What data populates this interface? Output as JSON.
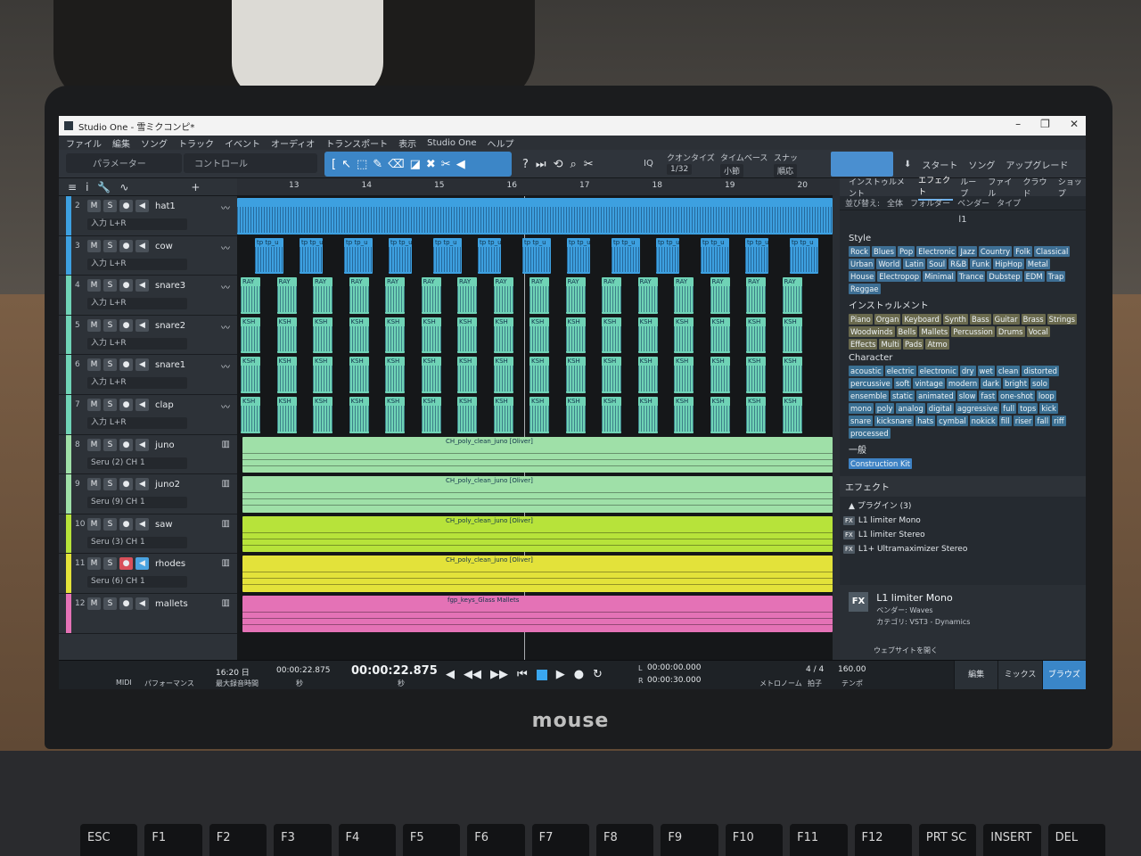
{
  "window": {
    "title": "Studio One - 雪ミクコンピ*"
  },
  "menu": [
    "ファイル",
    "編集",
    "ソング",
    "トラック",
    "イベント",
    "オーディオ",
    "トランスポート",
    "表示",
    "Studio One",
    "ヘルプ"
  ],
  "toolbar": {
    "param_label": "パラメーター",
    "control_label": "コントロール",
    "iq": "IQ",
    "quantize_label": "クオンタイズ",
    "quantize_value": "1/32",
    "timebase_label": "タイムベース",
    "timebase_value": "小節",
    "snap_label": "スナップ",
    "snap_value": "順応",
    "start": "スタート",
    "song": "ソング",
    "upgrade": "アップグレード"
  },
  "ruler": [
    "13",
    "14",
    "15",
    "16",
    "17",
    "18",
    "19",
    "20"
  ],
  "tracks": [
    {
      "num": "2",
      "name": "hat1",
      "input": "入力 L+R",
      "color": "#3da0e0"
    },
    {
      "num": "3",
      "name": "cow",
      "input": "入力 L+R",
      "color": "#3da0e0"
    },
    {
      "num": "4",
      "name": "snare3",
      "input": "入力 L+R",
      "color": "#6fd3b6"
    },
    {
      "num": "5",
      "name": "snare2",
      "input": "入力 L+R",
      "color": "#6fd3b6"
    },
    {
      "num": "6",
      "name": "snare1",
      "input": "入力 L+R",
      "color": "#6fd3b6"
    },
    {
      "num": "7",
      "name": "clap",
      "input": "入力 L+R",
      "color": "#6fd3b6"
    },
    {
      "num": "8",
      "name": "juno",
      "input": "Seru (2)   CH 1",
      "color": "#9fe0a8"
    },
    {
      "num": "9",
      "name": "juno2",
      "input": "Seru (9)   CH 1",
      "color": "#9fe0a8"
    },
    {
      "num": "10",
      "name": "saw",
      "input": "Seru (3)   CH 1",
      "color": "#b7e33a"
    },
    {
      "num": "11",
      "name": "rhodes",
      "input": "Seru (6)   CH 1",
      "color": "#e3e23a"
    },
    {
      "num": "12",
      "name": "mallets",
      "input": "",
      "color": "#e472b6"
    }
  ],
  "clips": {
    "hat": "tp tp_u",
    "snare": "RAY",
    "snare2": "KSH",
    "juno": "CH_poly_clean_juno [Oliver]",
    "mallets": "fgp_keys_Glass Mallets"
  },
  "browser": {
    "tabs": [
      "インストゥルメント",
      "エフェクト",
      "ループ",
      "ファイル",
      "クラウド",
      "ショップ"
    ],
    "sort": [
      "並び替え:",
      "全体",
      "フォルダー",
      "ベンダー",
      "タイプ"
    ],
    "search": "l1",
    "style_title": "Style",
    "style": [
      "Rock",
      "Blues",
      "Pop",
      "Electronic",
      "Jazz",
      "Country",
      "Folk",
      "Classical",
      "Urban",
      "World",
      "Latin",
      "Soul",
      "R&B",
      "Funk",
      "HipHop",
      "Metal",
      "House",
      "Electropop",
      "Minimal",
      "Trance",
      "Dubstep",
      "EDM",
      "Trap",
      "Reggae"
    ],
    "instrument_title": "インストゥルメント",
    "instrument": [
      "Piano",
      "Organ",
      "Keyboard",
      "Synth",
      "Bass",
      "Guitar",
      "Brass",
      "Strings",
      "Woodwinds",
      "Bells",
      "Mallets",
      "Percussion",
      "Drums",
      "Vocal",
      "Effects",
      "Multi",
      "Pads",
      "Atmo"
    ],
    "character_title": "Character",
    "character": [
      "acoustic",
      "electric",
      "electronic",
      "dry",
      "wet",
      "clean",
      "distorted",
      "percussive",
      "soft",
      "vintage",
      "modern",
      "dark",
      "bright",
      "solo",
      "ensemble",
      "static",
      "animated",
      "slow",
      "fast",
      "one-shot",
      "loop",
      "mono",
      "poly",
      "analog",
      "digital",
      "aggressive",
      "full",
      "tops",
      "kick",
      "snare",
      "kicksnare",
      "hats",
      "cymbal",
      "nokick",
      "fill",
      "riser",
      "fall",
      "riff",
      "processed"
    ],
    "general_title": "一般",
    "general": [
      "Construction Kit"
    ],
    "effects_title": "エフェクト",
    "plugins_label": "プラグイン (3)",
    "plugins": [
      "L1 limiter Mono",
      "L1 limiter Stereo",
      "L1+ Ultramaximizer Stereo"
    ],
    "detail": {
      "fx": "FX",
      "name": "L1 limiter Mono",
      "vendor": "ベンダー:   Waves",
      "category": "カテゴリ:   VST3 - Dynamics",
      "web": "ウェブサイトを開く"
    }
  },
  "transport": {
    "midi": "MIDI",
    "performance": "パフォーマンス",
    "record_days": "16:20 日",
    "record_max": "最大録音時間",
    "time_small": "00:00:22.875",
    "time_small_unit": "秒",
    "time_big": "00:00:22.875",
    "time_big_unit": "秒",
    "L": "00:00:00.000",
    "R": "00:00:30.000",
    "metronome": "メトロノーム",
    "signature": "4 / 4",
    "signature_label": "拍子",
    "tempo": "160.00",
    "tempo_label": "テンポ",
    "edit": "編集",
    "mix": "ミックス",
    "browse": "ブラウズ"
  },
  "laptop_brand": "mouse",
  "keyboard": [
    "ESC",
    "F1",
    "F2",
    "F3",
    "F4",
    "F5",
    "F6",
    "F7",
    "F8",
    "F9",
    "F10",
    "F11",
    "F12",
    "PRT SC",
    "INSERT",
    "DEL"
  ]
}
